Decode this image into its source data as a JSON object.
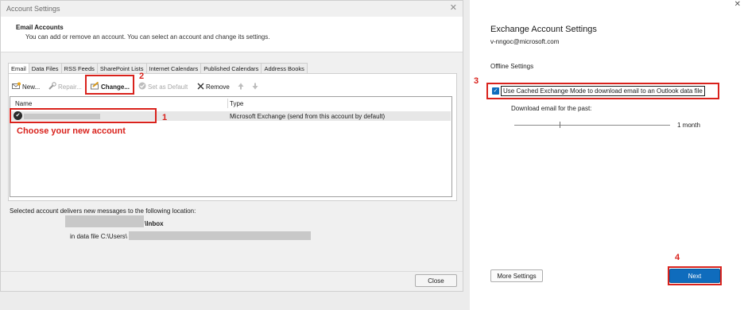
{
  "dialog": {
    "title": "Account Settings",
    "close_glyph": "✕",
    "header_title": "Email Accounts",
    "header_subtitle": "You can add or remove an account. You can select an account and change its settings.",
    "tabs": [
      "Email",
      "Data Files",
      "RSS Feeds",
      "SharePoint Lists",
      "Internet Calendars",
      "Published Calendars",
      "Address Books"
    ],
    "toolbar": {
      "new": "New...",
      "repair": "Repair...",
      "change": "Change...",
      "set_default": "Set as Default",
      "remove": "Remove"
    },
    "list": {
      "col_name": "Name",
      "col_type": "Type",
      "row_type": "Microsoft Exchange (send from this account by default)"
    },
    "deliver_text": "Selected account delivers new messages to the following location:",
    "inbox_text": "\\Inbox",
    "datafile_text": "in data file C:\\Users\\",
    "close_button": "Close"
  },
  "annotations": {
    "n1": "1",
    "n2": "2",
    "n3": "3",
    "n4": "4",
    "choose": "Choose your new account",
    "color": "#d9221c"
  },
  "panel": {
    "title": "Exchange Account Settings",
    "email": "v-nngoc@microsoft.com",
    "offline": "Offline Settings",
    "cached_label": "Use Cached Exchange Mode to download email to an Outlook data file",
    "cached_checked": true,
    "download_label": "Download email for the past:",
    "slider_value": "1 month",
    "more_settings": "More Settings",
    "next": "Next",
    "close_glyph": "✕",
    "accent": "#0f6cbd"
  }
}
